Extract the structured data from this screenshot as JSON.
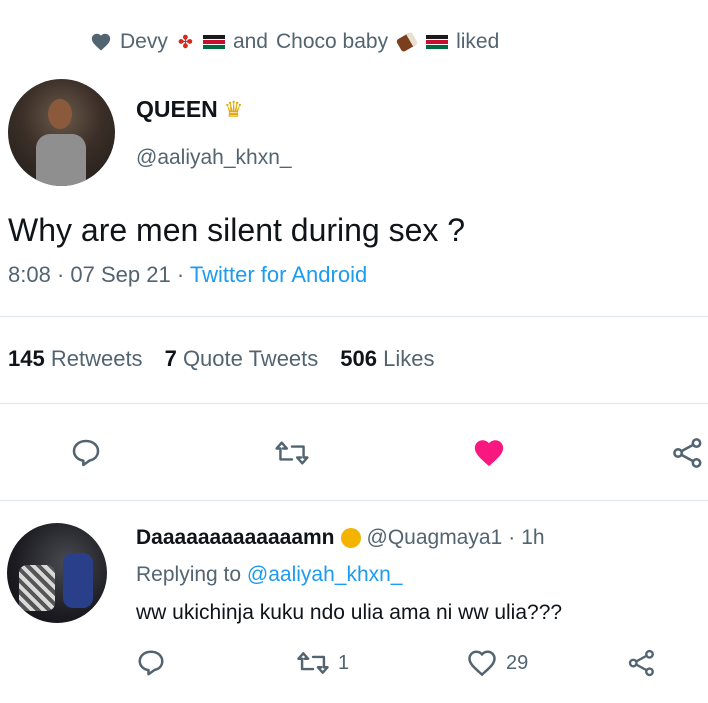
{
  "liked_bar": {
    "name1": "Devy",
    "conjunction": "and",
    "name2": "Choco baby",
    "action": "liked"
  },
  "tweet": {
    "display_name": "QUEEN",
    "handle": "@aaliyah_khxn_",
    "text": "Why are men silent during sex ?",
    "time": "8:08",
    "date": "07 Sep 21",
    "source": "Twitter for Android",
    "separator": "·"
  },
  "stats": {
    "retweets_count": "145",
    "retweets_label": "Retweets",
    "quotes_count": "7",
    "quotes_label": "Quote Tweets",
    "likes_count": "506",
    "likes_label": "Likes"
  },
  "reply": {
    "display_name": "Daaaaaaaaaaaaamn",
    "handle": "@Quagmaya1",
    "separator": "·",
    "time": "1h",
    "replying_prefix": "Replying to",
    "replying_handle": "@aaliyah_khxn_",
    "text": "ww ukichinja kuku ndo ulia ama ni ww ulia???",
    "retweet_count": "1",
    "like_count": "29"
  },
  "colors": {
    "accent": "#1d9bf0",
    "like_active": "#f91880",
    "muted": "#536471",
    "divider": "#e1e8ed"
  },
  "icons": [
    "heart-icon",
    "canada-flag-icon",
    "kenya-flag-icon",
    "chocolate-icon",
    "crown-icon",
    "reply-icon",
    "retweet-icon",
    "like-icon",
    "share-icon",
    "emoji-icon"
  ]
}
